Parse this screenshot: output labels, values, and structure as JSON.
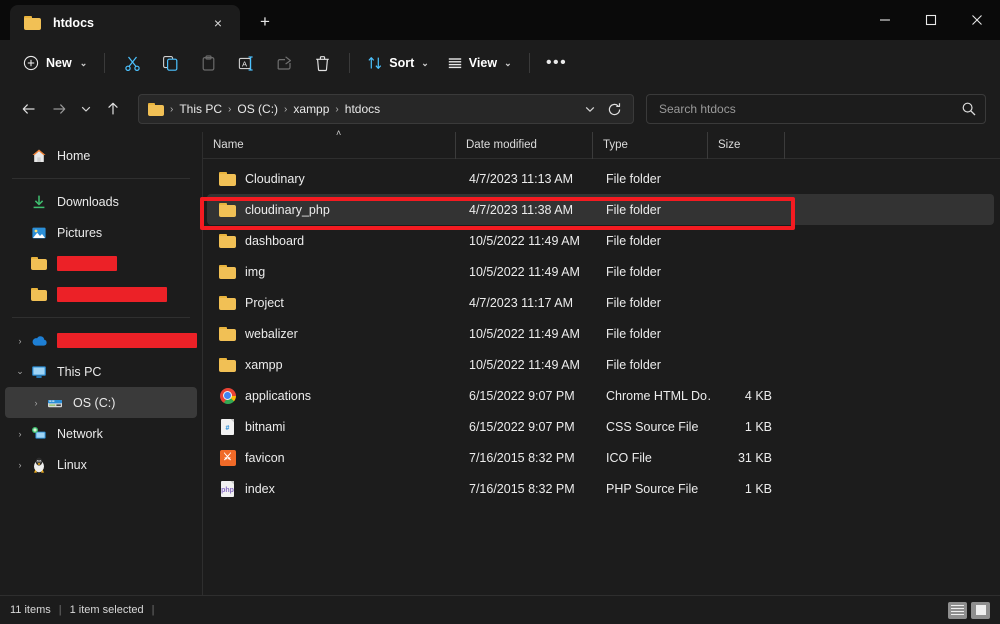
{
  "window": {
    "tab_title": "htdocs",
    "tab_close_icon": "×",
    "new_tab_icon": "+",
    "minimize_label": "Minimize",
    "maximize_label": "Maximize",
    "close_label": "Close"
  },
  "toolbar": {
    "new_label": "New",
    "new_icon": "⊕",
    "cut_label": "Cut",
    "copy_label": "Copy",
    "paste_label": "Paste",
    "rename_label": "Rename",
    "share_label": "Share",
    "delete_label": "Delete",
    "sort_label": "Sort",
    "view_label": "View",
    "more_label": "See more",
    "more_icon": "•••",
    "caret": "⌄"
  },
  "addressbar": {
    "back_icon": "←",
    "forward_icon": "→",
    "recent_icon": "⌄",
    "up_icon": "↑",
    "refresh_icon": "⟳",
    "crumbs": [
      "This PC",
      "OS (C:)",
      "xampp",
      "htdocs"
    ],
    "crumb_sep": "›",
    "dropdown_icon": "⌄"
  },
  "search": {
    "placeholder": "Search htdocs",
    "value": "",
    "icon": "search-icon"
  },
  "sidebar": {
    "items": [
      {
        "label": "Home",
        "icon": "home-icon",
        "chevron": "",
        "redacted": false,
        "selected": false,
        "indent": false
      },
      {
        "divider": true
      },
      {
        "label": "Downloads",
        "icon": "download-icon",
        "chevron": "",
        "redacted": false,
        "selected": false,
        "indent": false
      },
      {
        "label": "Pictures",
        "icon": "pictures-icon",
        "chevron": "",
        "redacted": false,
        "selected": false,
        "indent": false
      },
      {
        "label": "",
        "icon": "folder-icon",
        "chevron": "",
        "redacted": true,
        "redact_width": 60,
        "selected": false,
        "indent": false
      },
      {
        "label": "",
        "icon": "folder-icon",
        "chevron": "",
        "redacted": true,
        "redact_width": 110,
        "selected": false,
        "indent": false
      },
      {
        "divider": true
      },
      {
        "label": "",
        "icon": "onedrive-icon",
        "chevron": "›",
        "redacted": true,
        "redact_width": 142,
        "selected": false,
        "indent": false
      },
      {
        "label": "This PC",
        "icon": "this-pc-icon",
        "chevron": "⌄",
        "redacted": false,
        "selected": false,
        "indent": false
      },
      {
        "label": "OS (C:)",
        "icon": "drive-icon",
        "chevron": "›",
        "redacted": false,
        "selected": true,
        "indent": true
      },
      {
        "label": "Network",
        "icon": "network-icon",
        "chevron": "›",
        "redacted": false,
        "selected": false,
        "indent": false
      },
      {
        "label": "Linux",
        "icon": "linux-icon",
        "chevron": "›",
        "redacted": false,
        "selected": false,
        "indent": false
      }
    ]
  },
  "filelist": {
    "columns": {
      "name": "Name",
      "date_modified": "Date modified",
      "type": "Type",
      "size": "Size"
    },
    "sort_indicator": "˄",
    "rows": [
      {
        "name": "Cloudinary",
        "date": "4/7/2023 11:13 AM",
        "type": "File folder",
        "size": "",
        "icon": "folder-icon",
        "selected": false
      },
      {
        "name": "cloudinary_php",
        "date": "4/7/2023 11:38 AM",
        "type": "File folder",
        "size": "",
        "icon": "folder-icon",
        "selected": true
      },
      {
        "name": "dashboard",
        "date": "10/5/2022 11:49 AM",
        "type": "File folder",
        "size": "",
        "icon": "folder-icon",
        "selected": false
      },
      {
        "name": "img",
        "date": "10/5/2022 11:49 AM",
        "type": "File folder",
        "size": "",
        "icon": "folder-icon",
        "selected": false
      },
      {
        "name": "Project",
        "date": "4/7/2023 11:17 AM",
        "type": "File folder",
        "size": "",
        "icon": "folder-icon",
        "selected": false
      },
      {
        "name": "webalizer",
        "date": "10/5/2022 11:49 AM",
        "type": "File folder",
        "size": "",
        "icon": "folder-icon",
        "selected": false
      },
      {
        "name": "xampp",
        "date": "10/5/2022 11:49 AM",
        "type": "File folder",
        "size": "",
        "icon": "folder-icon",
        "selected": false
      },
      {
        "name": "applications",
        "date": "6/15/2022 9:07 PM",
        "type": "Chrome HTML Do…",
        "size": "4 KB",
        "icon": "chrome-icon",
        "selected": false
      },
      {
        "name": "bitnami",
        "date": "6/15/2022 9:07 PM",
        "type": "CSS Source File",
        "size": "1 KB",
        "icon": "css-file-icon",
        "selected": false
      },
      {
        "name": "favicon",
        "date": "7/16/2015 8:32 PM",
        "type": "ICO File",
        "size": "31 KB",
        "icon": "ico-file-icon",
        "selected": false
      },
      {
        "name": "index",
        "date": "7/16/2015 8:32 PM",
        "type": "PHP Source File",
        "size": "1 KB",
        "icon": "php-file-icon",
        "selected": false
      }
    ]
  },
  "statusbar": {
    "item_count": "11 items",
    "selection": "1 item selected",
    "separator": "|",
    "list_view_label": "Details view",
    "tiles_view_label": "Large icons view"
  },
  "annotation": {
    "highlight_color": "#f41b21",
    "target_row": "cloudinary_php"
  }
}
